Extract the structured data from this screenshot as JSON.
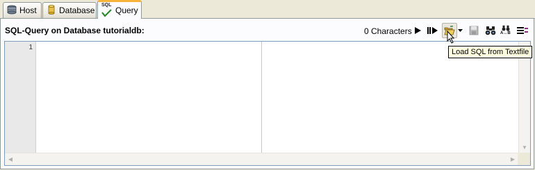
{
  "tabs": [
    {
      "label": "Host",
      "icon": "host-icon"
    },
    {
      "label": "Database",
      "icon": "database-icon"
    },
    {
      "label": "Query",
      "icon": "sql-query-icon",
      "icon_text": "SQL",
      "active": true
    }
  ],
  "header": {
    "title": "SQL-Query on Database tutorialdb:",
    "char_count": "0 Characters"
  },
  "toolbar": {
    "buttons": [
      {
        "name": "run-button",
        "icon": "play-icon"
      },
      {
        "name": "run-selection-button",
        "icon": "run-selection-icon"
      },
      {
        "name": "load-sql-button",
        "icon": "open-folder-icon",
        "hovered": true
      },
      {
        "name": "load-sql-dropdown",
        "icon": "dropdown-arrow-icon"
      },
      {
        "name": "save-button",
        "icon": "save-icon",
        "disabled": true
      },
      {
        "name": "find-button",
        "icon": "binoculars-icon"
      },
      {
        "name": "replace-button",
        "icon": "find-replace-icon",
        "icon_text": "A↔B"
      },
      {
        "name": "wrap-button",
        "icon": "word-wrap-icon"
      }
    ],
    "tooltip": "Load SQL from Textfile"
  },
  "editor": {
    "line_numbers": [
      "1"
    ],
    "content": ""
  },
  "colors": {
    "active_tab_accent": "#f8b33a",
    "tooltip_bg": "#ffffe1",
    "editor_border": "#7f9db9"
  }
}
